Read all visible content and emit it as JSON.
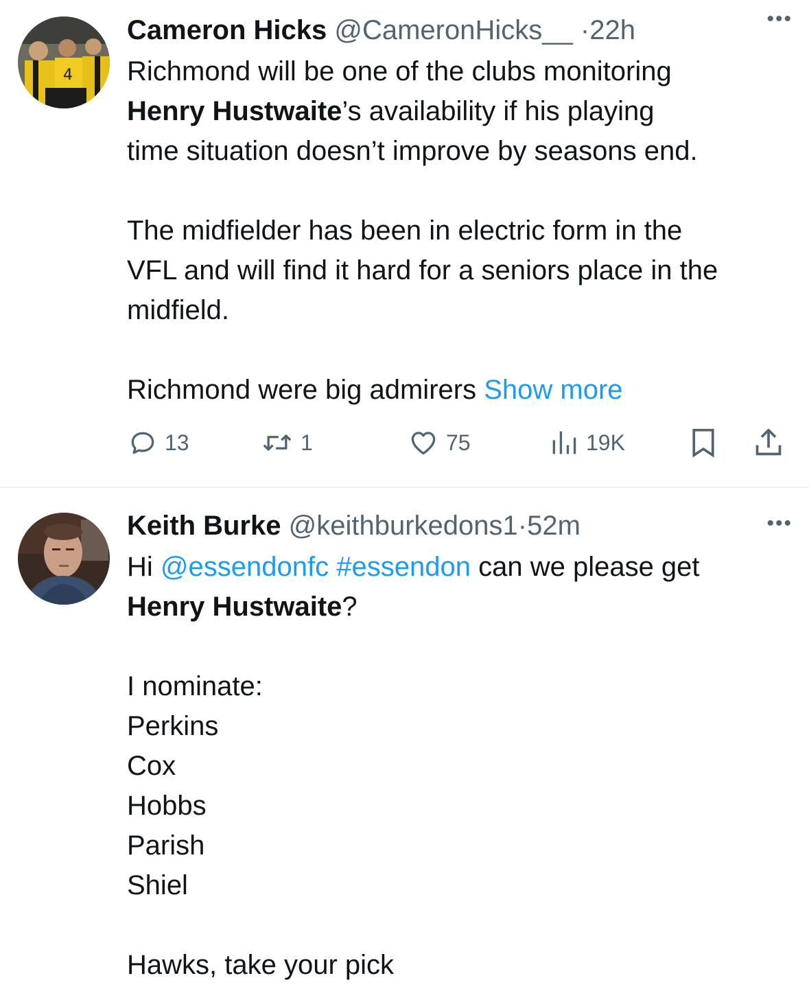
{
  "tweets": [
    {
      "author": {
        "name": "Cameron Hicks",
        "handle": "@CameronHicks__"
      },
      "separator": "·",
      "time": "22h",
      "more_icon": "ellipsis-icon",
      "body": {
        "p1_line1": "Richmond will be one of the clubs monitoring",
        "p1_bold": "Henry Hustwaite",
        "p1_line2_rest": "’s availability if his playing",
        "p1_line3": "time situation doesn’t improve by seasons end.",
        "p2_line1": "The midfielder has been in electric form in the",
        "p2_line2": "VFL and will find it hard for a seniors place in the",
        "p2_line3": "midfield.",
        "p3_text": "Richmond were big admirers",
        "show_more": "Show more"
      },
      "actions": {
        "replies": "13",
        "retweets": "1",
        "likes": "75",
        "views": "19K"
      }
    },
    {
      "author": {
        "name": "Keith Burke",
        "handle": "@keithburkedons1"
      },
      "separator": "·",
      "time": "52m",
      "more_icon": "ellipsis-icon",
      "body": {
        "greeting": "Hi",
        "mention": "@essendonfc",
        "hashtag": "#essendon",
        "line1_rest": "can we please get",
        "bold_name": "Henry Hustwaite",
        "question": "?",
        "nominate": "I nominate:",
        "names": [
          "Perkins",
          "Cox",
          "Hobbs",
          "Parish",
          "Shiel"
        ],
        "closing": "Hawks, take your pick"
      }
    }
  ],
  "colors": {
    "text": "#0f1419",
    "secondary": "#536471",
    "link": "#1d9bf0",
    "divider": "#eff3f4"
  }
}
